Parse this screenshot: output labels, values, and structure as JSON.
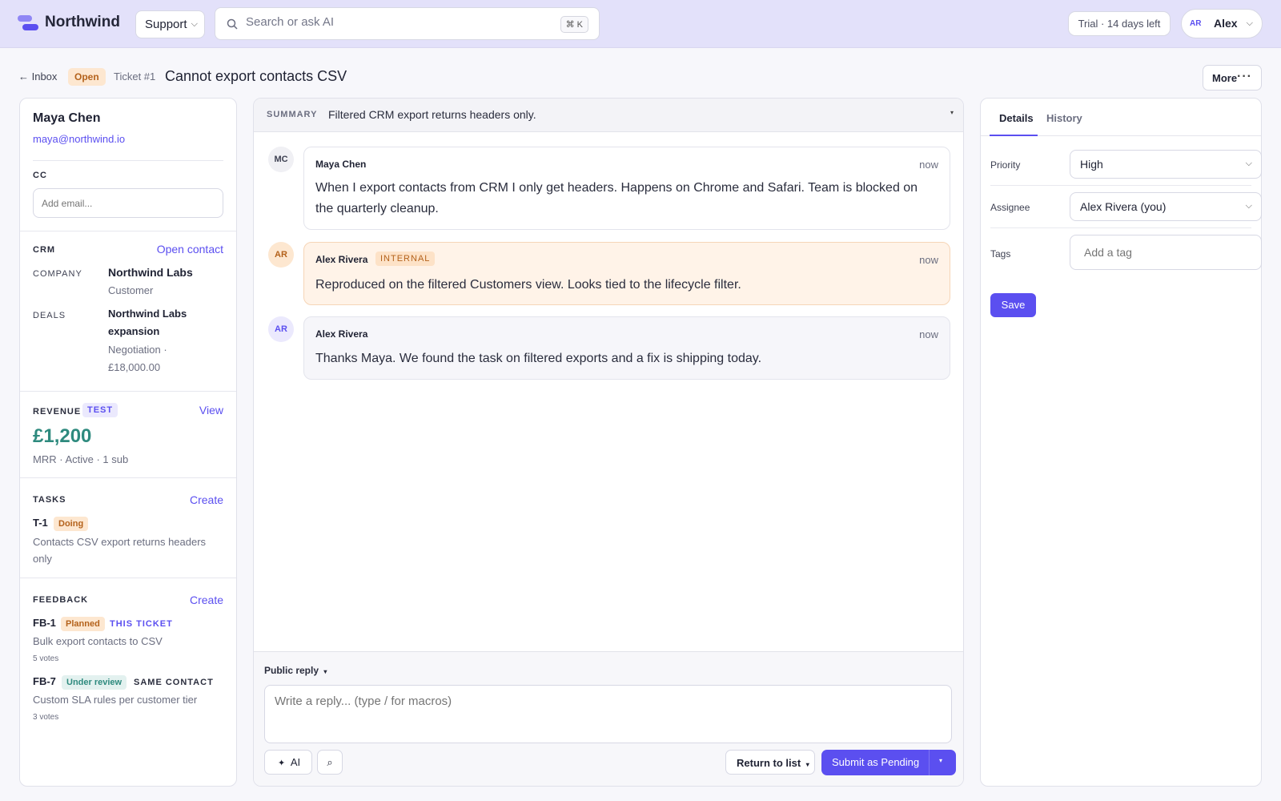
{
  "topbar": {
    "brand": "Northwind",
    "workspace": "Support",
    "search_placeholder": "Search or ask AI",
    "search_shortcut": "⌘ K",
    "trial": "Trial · 14 days left",
    "user_initials": "AR",
    "user_name": "Alex"
  },
  "ticket": {
    "back": "← Inbox",
    "status": "Open",
    "number": "Ticket #1",
    "title": "Cannot export contacts CSV",
    "more": "More"
  },
  "contact": {
    "name": "Maya Chen",
    "email": "maya@northwind.io",
    "cc_label": "CC",
    "cc_placeholder": "Add email..."
  },
  "crm": {
    "label": "CRM",
    "action": "Open contact",
    "company_label": "COMPANY",
    "company": "Northwind Labs",
    "company_type": "Customer",
    "deals_label": "DEALS",
    "deal_name_1": "Northwind Labs",
    "deal_name_2": "expansion",
    "deal_stage": "Negotiation ·",
    "deal_value": "£18,000.00"
  },
  "revenue": {
    "label": "REVENUE",
    "badge": "TEST",
    "action": "View",
    "amount": "£1,200",
    "meta": "MRR · Active · 1 sub"
  },
  "tasks": {
    "label": "TASKS",
    "action": "Create",
    "items": [
      {
        "id": "T-1",
        "status": "Doing",
        "text_1": "Contacts CSV export returns headers",
        "text_2": "only"
      }
    ]
  },
  "feedback": {
    "label": "FEEDBACK",
    "action": "Create",
    "items": [
      {
        "id": "FB-1",
        "status": "Planned",
        "tag": "THIS TICKET",
        "title": "Bulk export contacts to CSV",
        "votes": "5 votes"
      },
      {
        "id": "FB-7",
        "status": "Under review",
        "tag": "SAME CONTACT",
        "title": "Custom SLA rules per customer tier",
        "votes": "3 votes"
      }
    ]
  },
  "conversation": {
    "summary_label": "SUMMARY",
    "summary": "Filtered CRM export returns headers only.",
    "messages": [
      {
        "initials": "MC",
        "author": "Maya Chen",
        "time": "now",
        "line_1": "When I export contacts from CRM I only get headers. Happens on Chrome and Safari. Team is blocked on",
        "line_2": "the quarterly cleanup."
      },
      {
        "initials": "AR",
        "author": "Alex Rivera",
        "badge": "INTERNAL",
        "time": "now",
        "line_1": "Reproduced on the filtered Customers view. Looks tied to the lifecycle filter."
      },
      {
        "initials": "AR",
        "author": "Alex Rivera",
        "time": "now",
        "line_1": "Thanks Maya. We found the task on filtered exports and a fix is shipping today."
      }
    ]
  },
  "composer": {
    "mode": "Public reply",
    "placeholder": "Write a reply... (type / for macros)",
    "ai": "AI",
    "return": "Return to list",
    "submit": "Submit as Pending"
  },
  "details": {
    "tabs": [
      "Details",
      "History"
    ],
    "priority_label": "Priority",
    "priority": "High",
    "assignee_label": "Assignee",
    "assignee": "Alex Rivera (you)",
    "tags_label": "Tags",
    "tags_placeholder": "Add a tag",
    "save": "Save"
  },
  "colors": {
    "accent": "#5b4ff0",
    "revenue": "#2e8a7e",
    "topbar": "#e3e1fa",
    "internal_bg": "#fff3e8"
  }
}
